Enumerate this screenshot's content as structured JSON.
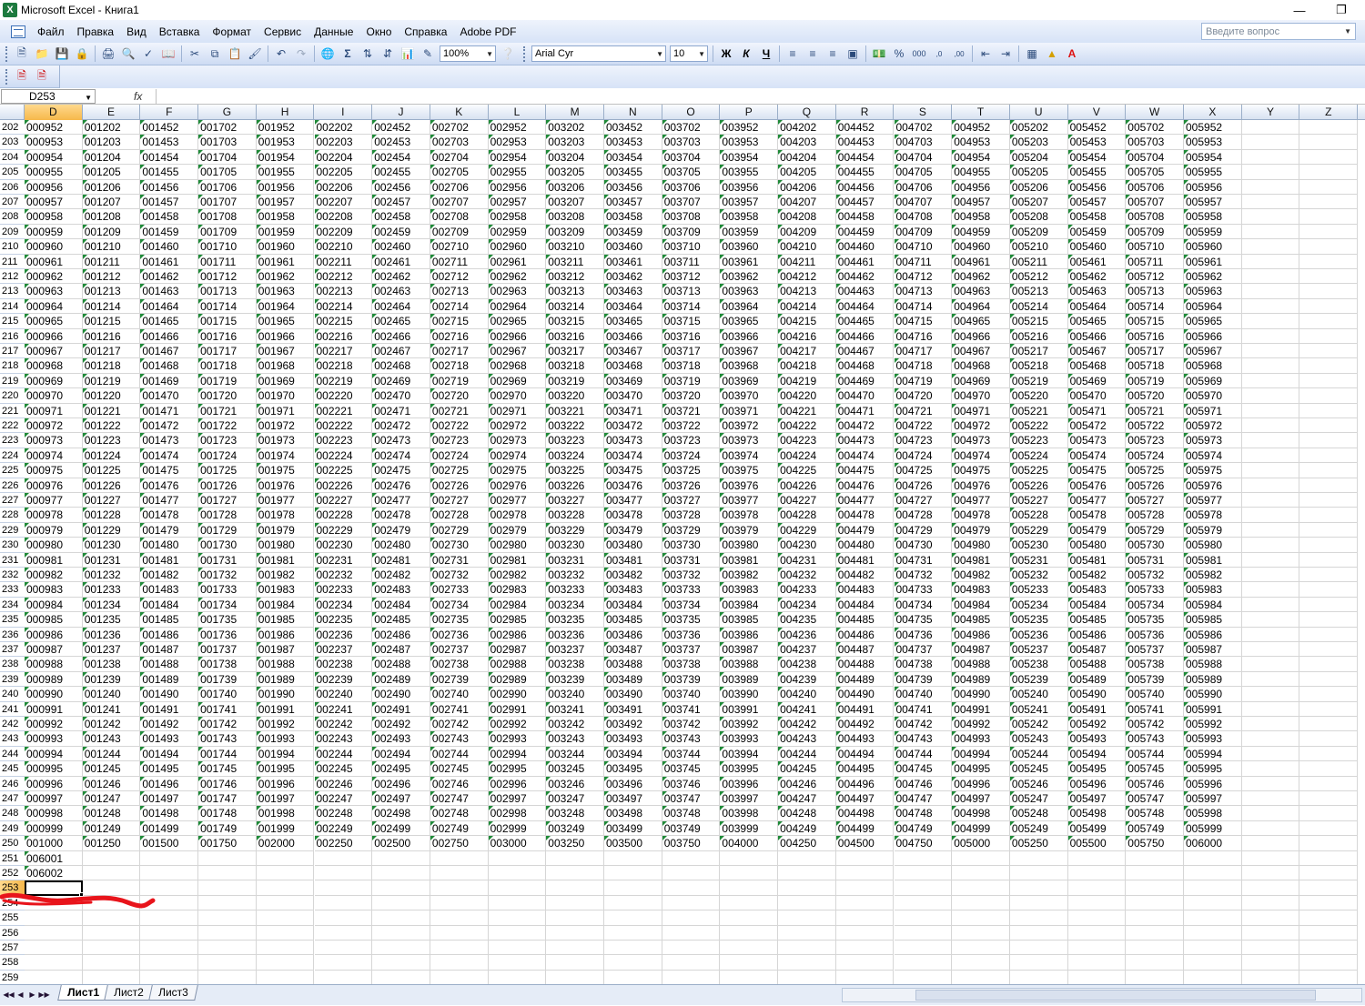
{
  "window": {
    "title": "Microsoft Excel - Книга1",
    "app_icon": "X"
  },
  "menu": {
    "items": [
      "Файл",
      "Правка",
      "Вид",
      "Вставка",
      "Формат",
      "Сервис",
      "Данные",
      "Окно",
      "Справка",
      "Adobe PDF"
    ],
    "help_placeholder": "Введите вопрос"
  },
  "toolbar": {
    "zoom": "100%",
    "font_name": "Arial Cyr",
    "font_size": "10",
    "bold": "Ж",
    "italic": "К",
    "underline": "Ч"
  },
  "formula_bar": {
    "name_box": "D253",
    "fx": "fx",
    "formula": ""
  },
  "grid": {
    "columns": [
      "D",
      "E",
      "F",
      "G",
      "H",
      "I",
      "J",
      "K",
      "L",
      "M",
      "N",
      "O",
      "P",
      "Q",
      "R",
      "S",
      "T",
      "U",
      "V",
      "W",
      "X",
      "Y",
      "Z"
    ],
    "active_column": "D",
    "active_row": 253,
    "first_row": 202,
    "last_row": 259,
    "data_last_row": 250,
    "col_start_values": [
      952,
      1202,
      1452,
      1702,
      1952,
      2202,
      2452,
      2702,
      2952,
      3202,
      3452,
      3702,
      3952,
      4202,
      4452,
      4702,
      4952,
      5202,
      5452,
      5702,
      5952
    ],
    "extra_cells": [
      {
        "row": 251,
        "col": "D",
        "value": "006001"
      },
      {
        "row": 252,
        "col": "D",
        "value": "006002"
      }
    ],
    "row_250_overrides": {
      "E": "001250",
      "F": "001500",
      "G": "001750",
      "H": "002000"
    }
  },
  "sheets": {
    "tabs": [
      "Лист1",
      "Лист2",
      "Лист3"
    ],
    "active": "Лист1"
  },
  "colors": {
    "selection": "#000000",
    "scribble": "#e8141b",
    "text_indicator": "#1f8a38"
  }
}
